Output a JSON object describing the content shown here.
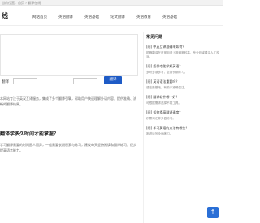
{
  "topbar": {
    "text": "当前位置：首页 › 翻译在线"
  },
  "header": {
    "logo": "线"
  },
  "nav": [
    "网站首页",
    "英语翻译",
    "英语基础",
    "论文翻译",
    "英语教育",
    "英语基础"
  ],
  "translator": {
    "label": "翻译",
    "button": "翻译"
  },
  "intro": {
    "text": "本网站专注于英汉互译服务，集成了多个翻译引擎，帮助用户快速理解外语内容，提供准确、流畅的翻译结果。"
  },
  "faq": {
    "title": "翻译学多久时间才能掌握？",
    "body": "学习翻译需要的时间因人而异，一般需要长期积累与练习，建议每天坚持阅读和翻译练习，逐步提高语言能力。"
  },
  "side": {
    "title": "常见问题",
    "items": [
      {
        "title": "[问] 中英互译准确率如何？",
        "text": "机器翻译在日常用语上准确率较高，专业领域建议人工校对。"
      },
      {
        "title": "[问] 怎样才能学好英语？",
        "text": "多听多读多写，坚持长期练习。"
      },
      {
        "title": "[问] 英语语法重要吗？",
        "text": "语法是基础，有助于准确表达。"
      },
      {
        "title": "[问] 翻译软件哪个好？",
        "text": "可根据需求选择不同工具。"
      },
      {
        "title": "[问] 如何提高翻译速度？",
        "text": "积累词汇并多做练习。"
      },
      {
        "title": "[问] 学习英语的方法有哪些？",
        "text": "听说读写全面练习。"
      }
    ]
  },
  "scroll_top": {
    "label": "↑"
  }
}
